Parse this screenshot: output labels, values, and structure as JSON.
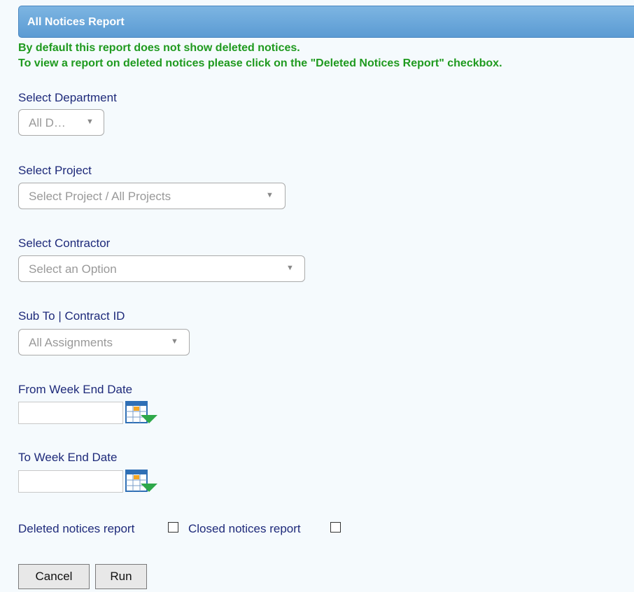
{
  "header": {
    "title": "All Notices Report"
  },
  "notice": {
    "line1": "By default this report does not show deleted notices.",
    "line2": "To view a report on deleted notices please click on the \"Deleted Notices Report\" checkbox."
  },
  "department": {
    "label": "Select Department",
    "value": "All D…"
  },
  "project": {
    "label": "Select Project",
    "value": "Select Project / All Projects"
  },
  "contractor": {
    "label": "Select Contractor",
    "value": "Select an Option"
  },
  "sub_to": {
    "label": "Sub To | Contract ID",
    "value": "All Assignments"
  },
  "from_date": {
    "label": "From Week End Date",
    "value": ""
  },
  "to_date": {
    "label": "To Week End Date",
    "value": ""
  },
  "checkboxes": {
    "deleted_label": "Deleted notices report",
    "closed_label": "Closed notices report"
  },
  "buttons": {
    "cancel": "Cancel",
    "run": "Run"
  },
  "icons": {
    "calendar": "calendar-icon",
    "dropdown": "triangle-down-icon"
  },
  "colors": {
    "header": "#6aa7dc",
    "notice": "#1f9a1f",
    "label": "#1e2a7a"
  }
}
